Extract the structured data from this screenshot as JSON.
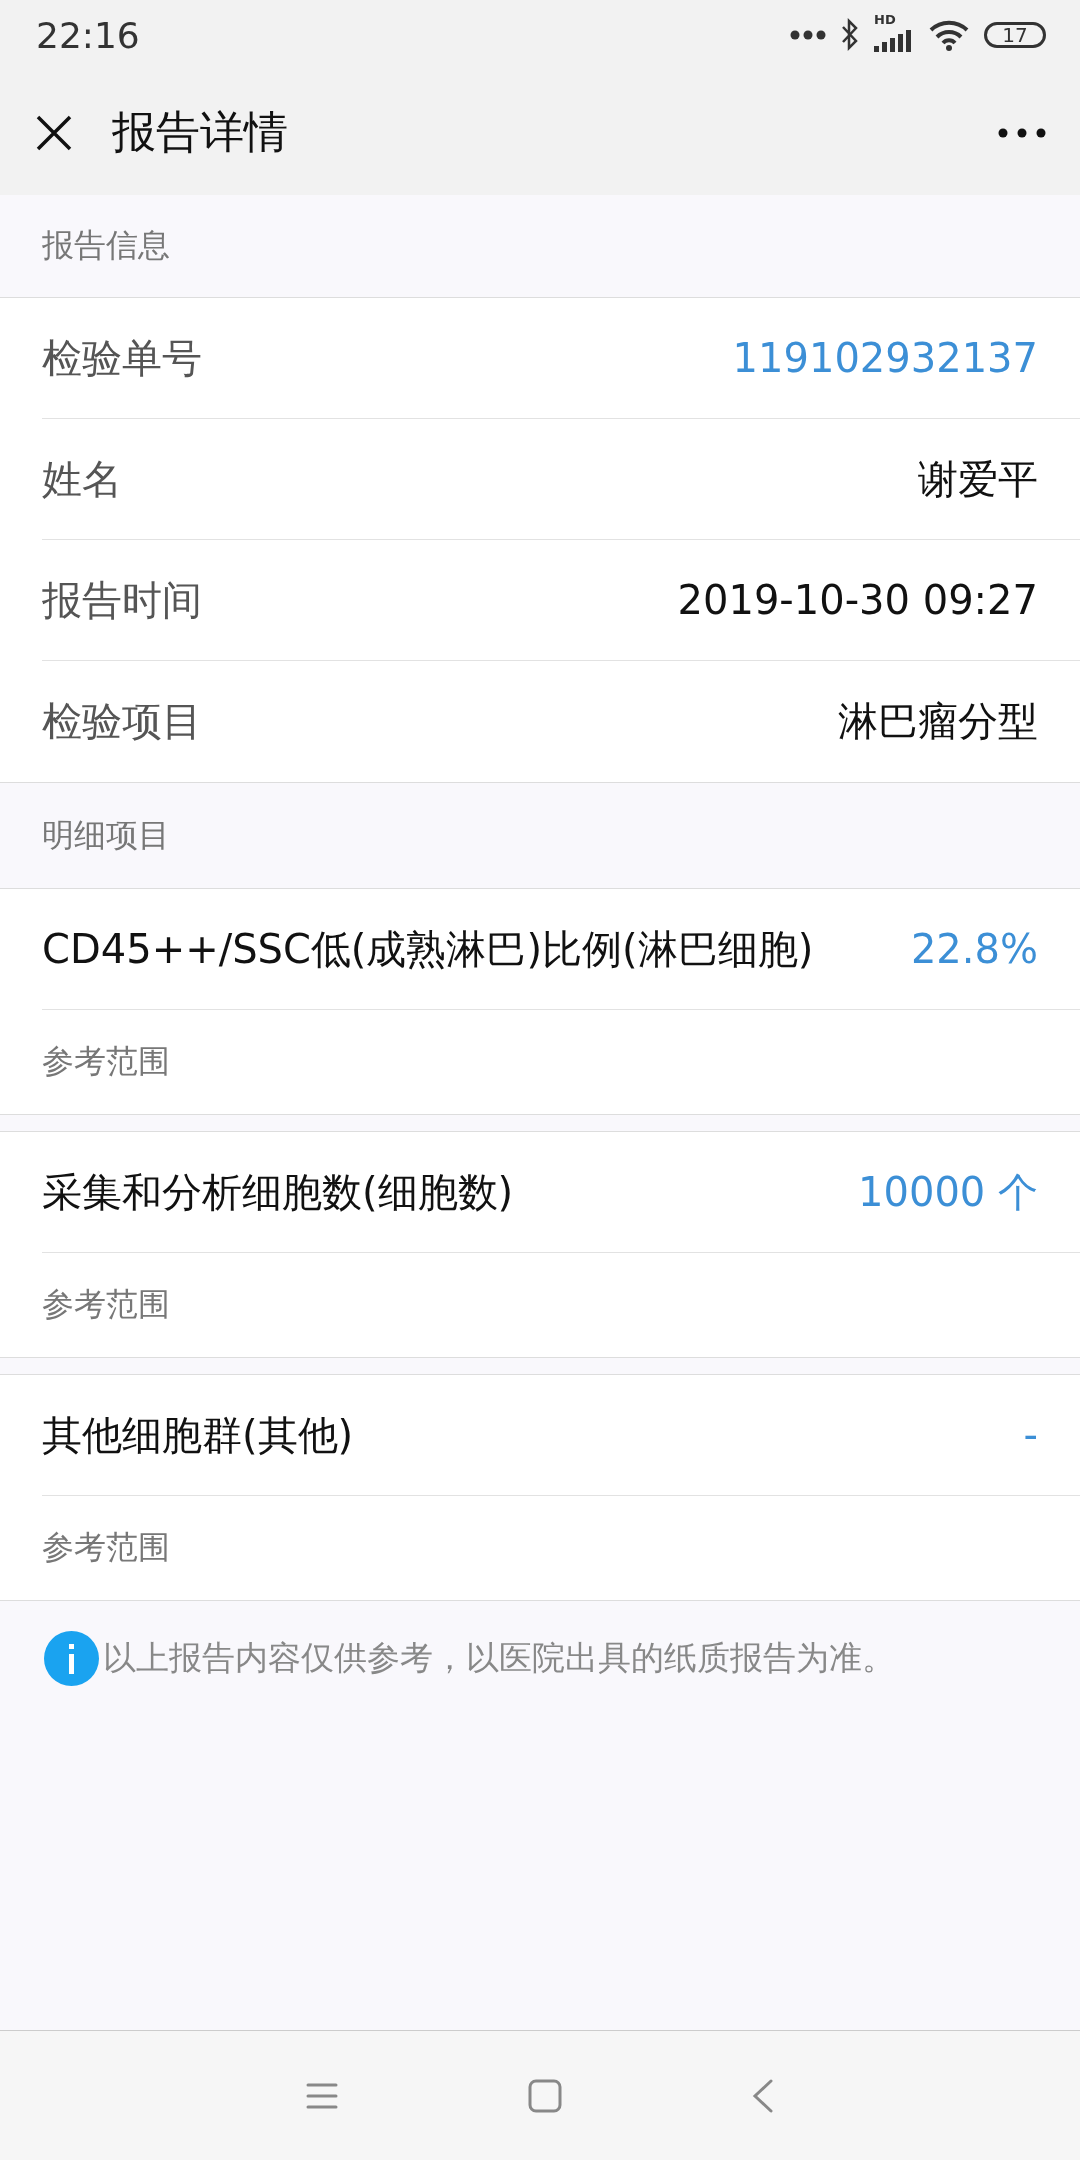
{
  "status_bar": {
    "time": "22:16",
    "network_label": "HD",
    "battery": "17"
  },
  "header": {
    "title": "报告详情"
  },
  "report_info": {
    "heading": "报告信息",
    "rows": [
      {
        "label": "检验单号",
        "value": "119102932137",
        "kind": "link"
      },
      {
        "label": "姓名",
        "value": "谢爱平",
        "kind": "plain"
      },
      {
        "label": "报告时间",
        "value": "2019-10-30 09:27",
        "kind": "plain"
      },
      {
        "label": "检验项目",
        "value": "淋巴瘤分型",
        "kind": "plain"
      }
    ]
  },
  "details": {
    "heading": "明细项目",
    "items": [
      {
        "name": "CD45++/SSC低(成熟淋巴)比例(淋巴细胞)",
        "result": "22.8%",
        "reference_label": "参考范围"
      },
      {
        "name": "采集和分析细胞数(细胞数)",
        "result": "10000 个",
        "reference_label": "参考范围"
      },
      {
        "name": "其他细胞群(其他)",
        "result": "-",
        "reference_label": "参考范围"
      }
    ]
  },
  "notice": "以上报告内容仅供参考，以医院出具的纸质报告为准。"
}
